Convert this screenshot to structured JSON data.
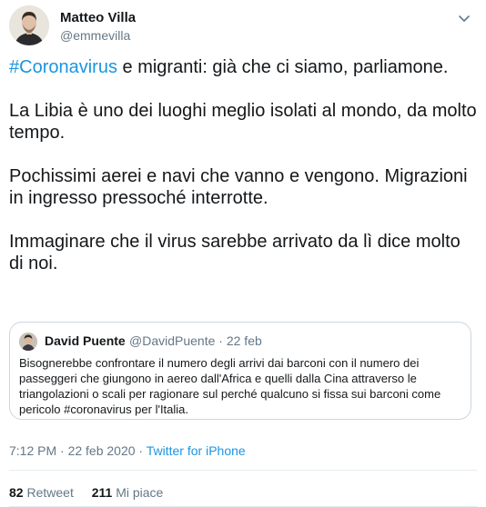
{
  "author": {
    "name": "Matteo Villa",
    "handle": "@emmevilla"
  },
  "tweet": {
    "hashtag": "#Coronavirus",
    "line1_rest": " e migranti: già che ci siamo, parliamone.",
    "paragraphs": [
      "La Libia è uno dei luoghi meglio isolati al mondo, da molto tempo.",
      "Pochissimi aerei e navi che vanno e vengono. Migrazioni in ingresso pressoché interrotte.",
      "Immaginare che il virus sarebbe arrivato da lì dice molto di noi."
    ]
  },
  "quoted": {
    "name": "David Puente",
    "handle": "@DavidPuente",
    "separator": " · ",
    "date": "22 feb",
    "text": "Bisognerebbe confrontare il numero degli arrivi dai barconi con il numero dei passeggeri che giungono in aereo dall'Africa e quelli dalla Cina attraverso le triangolazioni o scali per ragionare sul perché qualcuno si fissa sui barconi come pericolo #coronavirus per l'Italia."
  },
  "meta": {
    "time_date": "7:12 PM · 22 feb 2020 · ",
    "source": "Twitter for iPhone"
  },
  "stats": {
    "retweets_count": "82",
    "retweets_label": "Retweet",
    "likes_count": "211",
    "likes_label": "Mi piace"
  },
  "colors": {
    "link": "#1b95e0",
    "secondary": "#657786",
    "border": "#ccd6dd"
  },
  "icons": {
    "menu": "chevron-down-icon"
  }
}
